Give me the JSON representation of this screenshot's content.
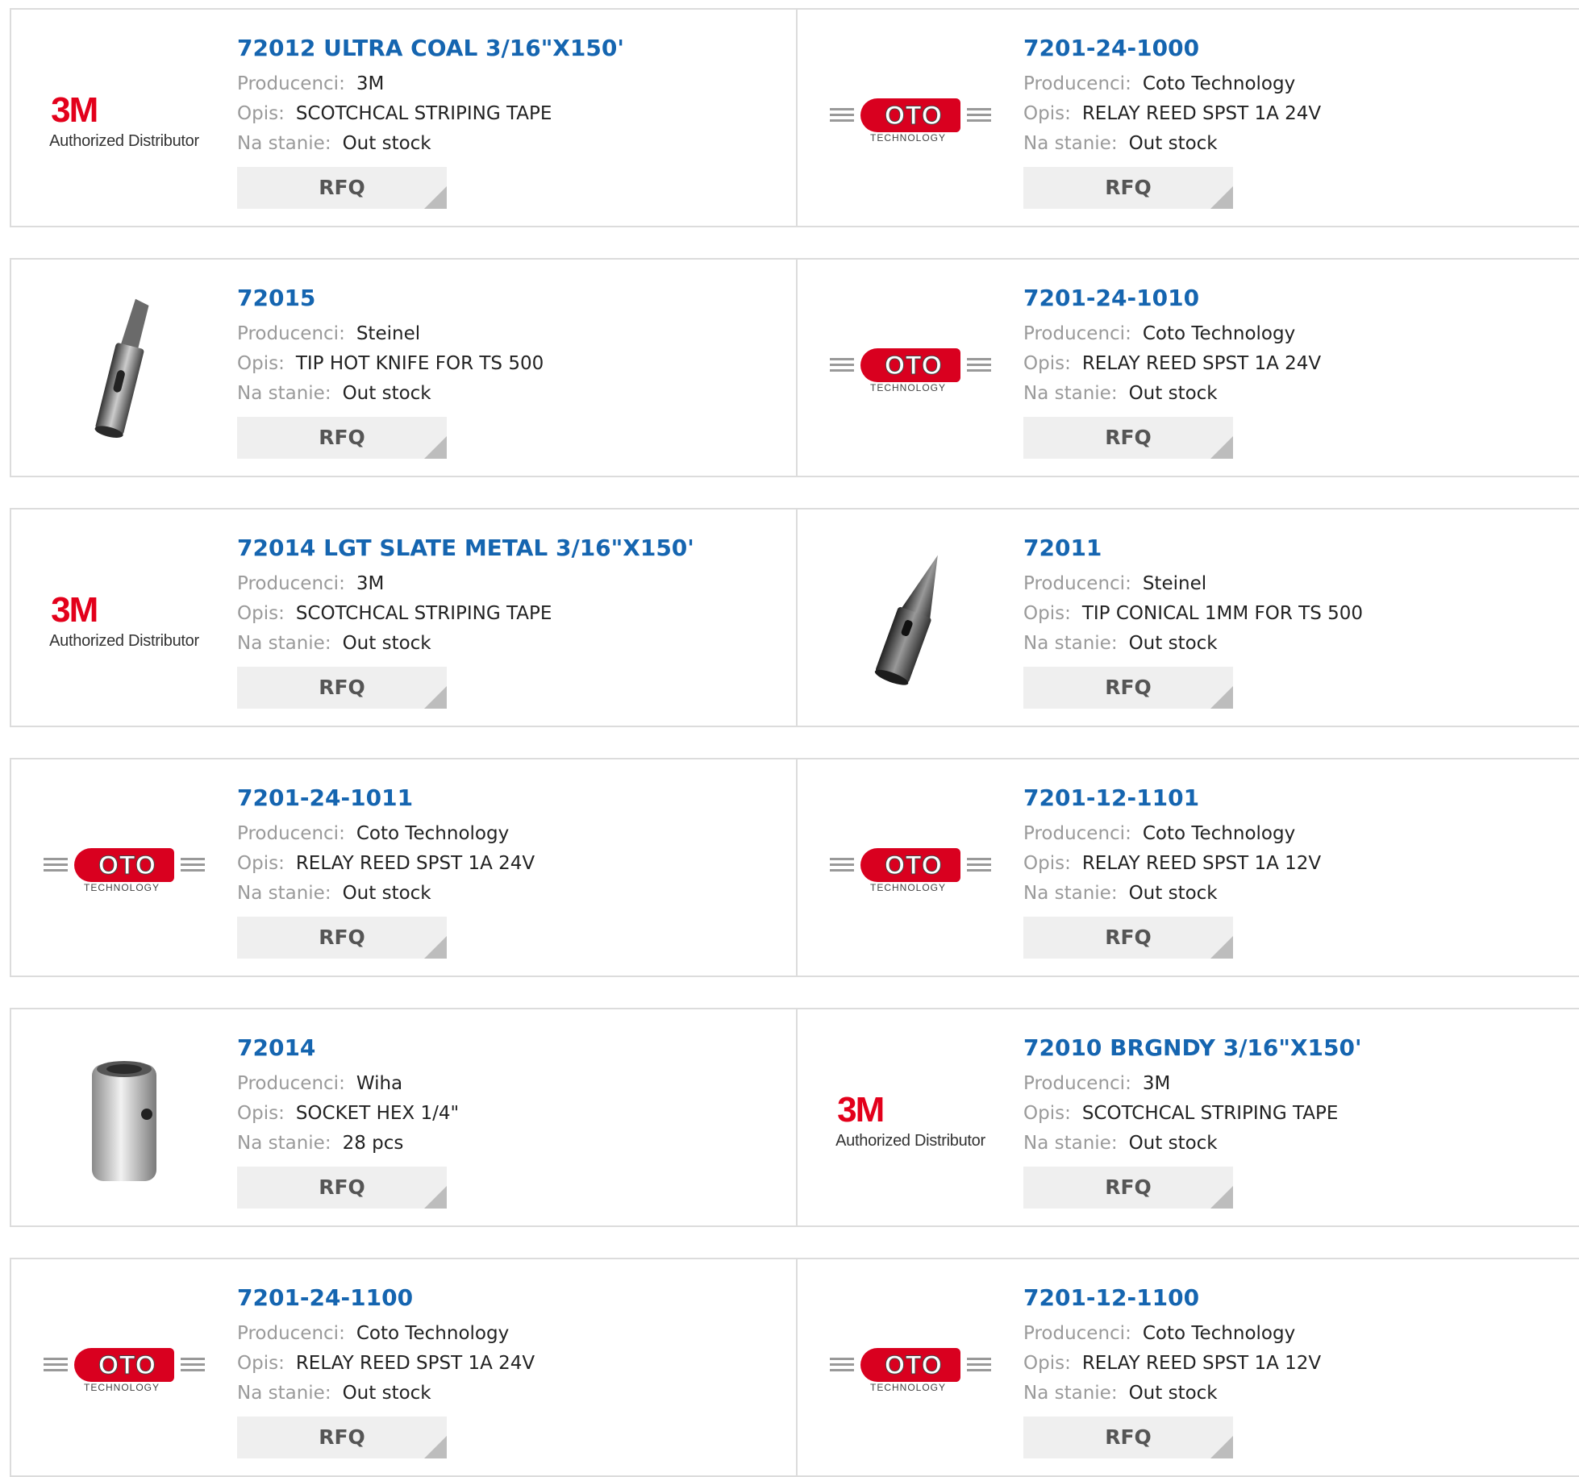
{
  "labels": {
    "manufacturer": "Producenci:",
    "description": "Opis:",
    "stock": "Na stanie:",
    "rfq": "RFQ"
  },
  "logo_text": {
    "three_m": "3M",
    "authorized": "Authorized Distributor",
    "coto": "OTO",
    "coto_sub": "TECHNOLOGY"
  },
  "colors": {
    "title": "#1565b0",
    "label": "#9a9a9a",
    "rfq_bg": "#efefef",
    "three_m_red": "#e3001b",
    "coto_red": "#d9001f"
  },
  "products": [
    {
      "title": "72012 ULTRA COAL 3/16\"X150'",
      "manufacturer": "3M",
      "description": "SCOTCHCAL STRIPING TAPE",
      "stock": "Out stock",
      "image": "3m-logo"
    },
    {
      "title": "7201-24-1000",
      "manufacturer": "Coto Technology",
      "description": "RELAY REED SPST 1A 24V",
      "stock": "Out stock",
      "image": "coto-logo"
    },
    {
      "title": "72015",
      "manufacturer": "Steinel",
      "description": "TIP HOT KNIFE FOR TS 500",
      "stock": "Out stock",
      "image": "hot-knife-tip"
    },
    {
      "title": "7201-24-1010",
      "manufacturer": "Coto Technology",
      "description": "RELAY REED SPST 1A 24V",
      "stock": "Out stock",
      "image": "coto-logo"
    },
    {
      "title": "72014 LGT SLATE METAL 3/16\"X150'",
      "manufacturer": "3M",
      "description": "SCOTCHCAL STRIPING TAPE",
      "stock": "Out stock",
      "image": "3m-logo"
    },
    {
      "title": "72011",
      "manufacturer": "Steinel",
      "description": "TIP CONICAL 1MM FOR TS 500",
      "stock": "Out stock",
      "image": "conical-tip"
    },
    {
      "title": "7201-24-1011",
      "manufacturer": "Coto Technology",
      "description": "RELAY REED SPST 1A 24V",
      "stock": "Out stock",
      "image": "coto-logo"
    },
    {
      "title": "7201-12-1101",
      "manufacturer": "Coto Technology",
      "description": "RELAY REED SPST 1A 12V",
      "stock": "Out stock",
      "image": "coto-logo"
    },
    {
      "title": "72014",
      "manufacturer": "Wiha",
      "description": "SOCKET HEX 1/4\"",
      "stock": "28 pcs",
      "image": "hex-socket"
    },
    {
      "title": "72010 BRGNDY 3/16\"X150'",
      "manufacturer": "3M",
      "description": "SCOTCHCAL STRIPING TAPE",
      "stock": "Out stock",
      "image": "3m-logo"
    },
    {
      "title": "7201-24-1100",
      "manufacturer": "Coto Technology",
      "description": "RELAY REED SPST 1A 24V",
      "stock": "Out stock",
      "image": "coto-logo"
    },
    {
      "title": "7201-12-1100",
      "manufacturer": "Coto Technology",
      "description": "RELAY REED SPST 1A 12V",
      "stock": "Out stock",
      "image": "coto-logo"
    }
  ]
}
